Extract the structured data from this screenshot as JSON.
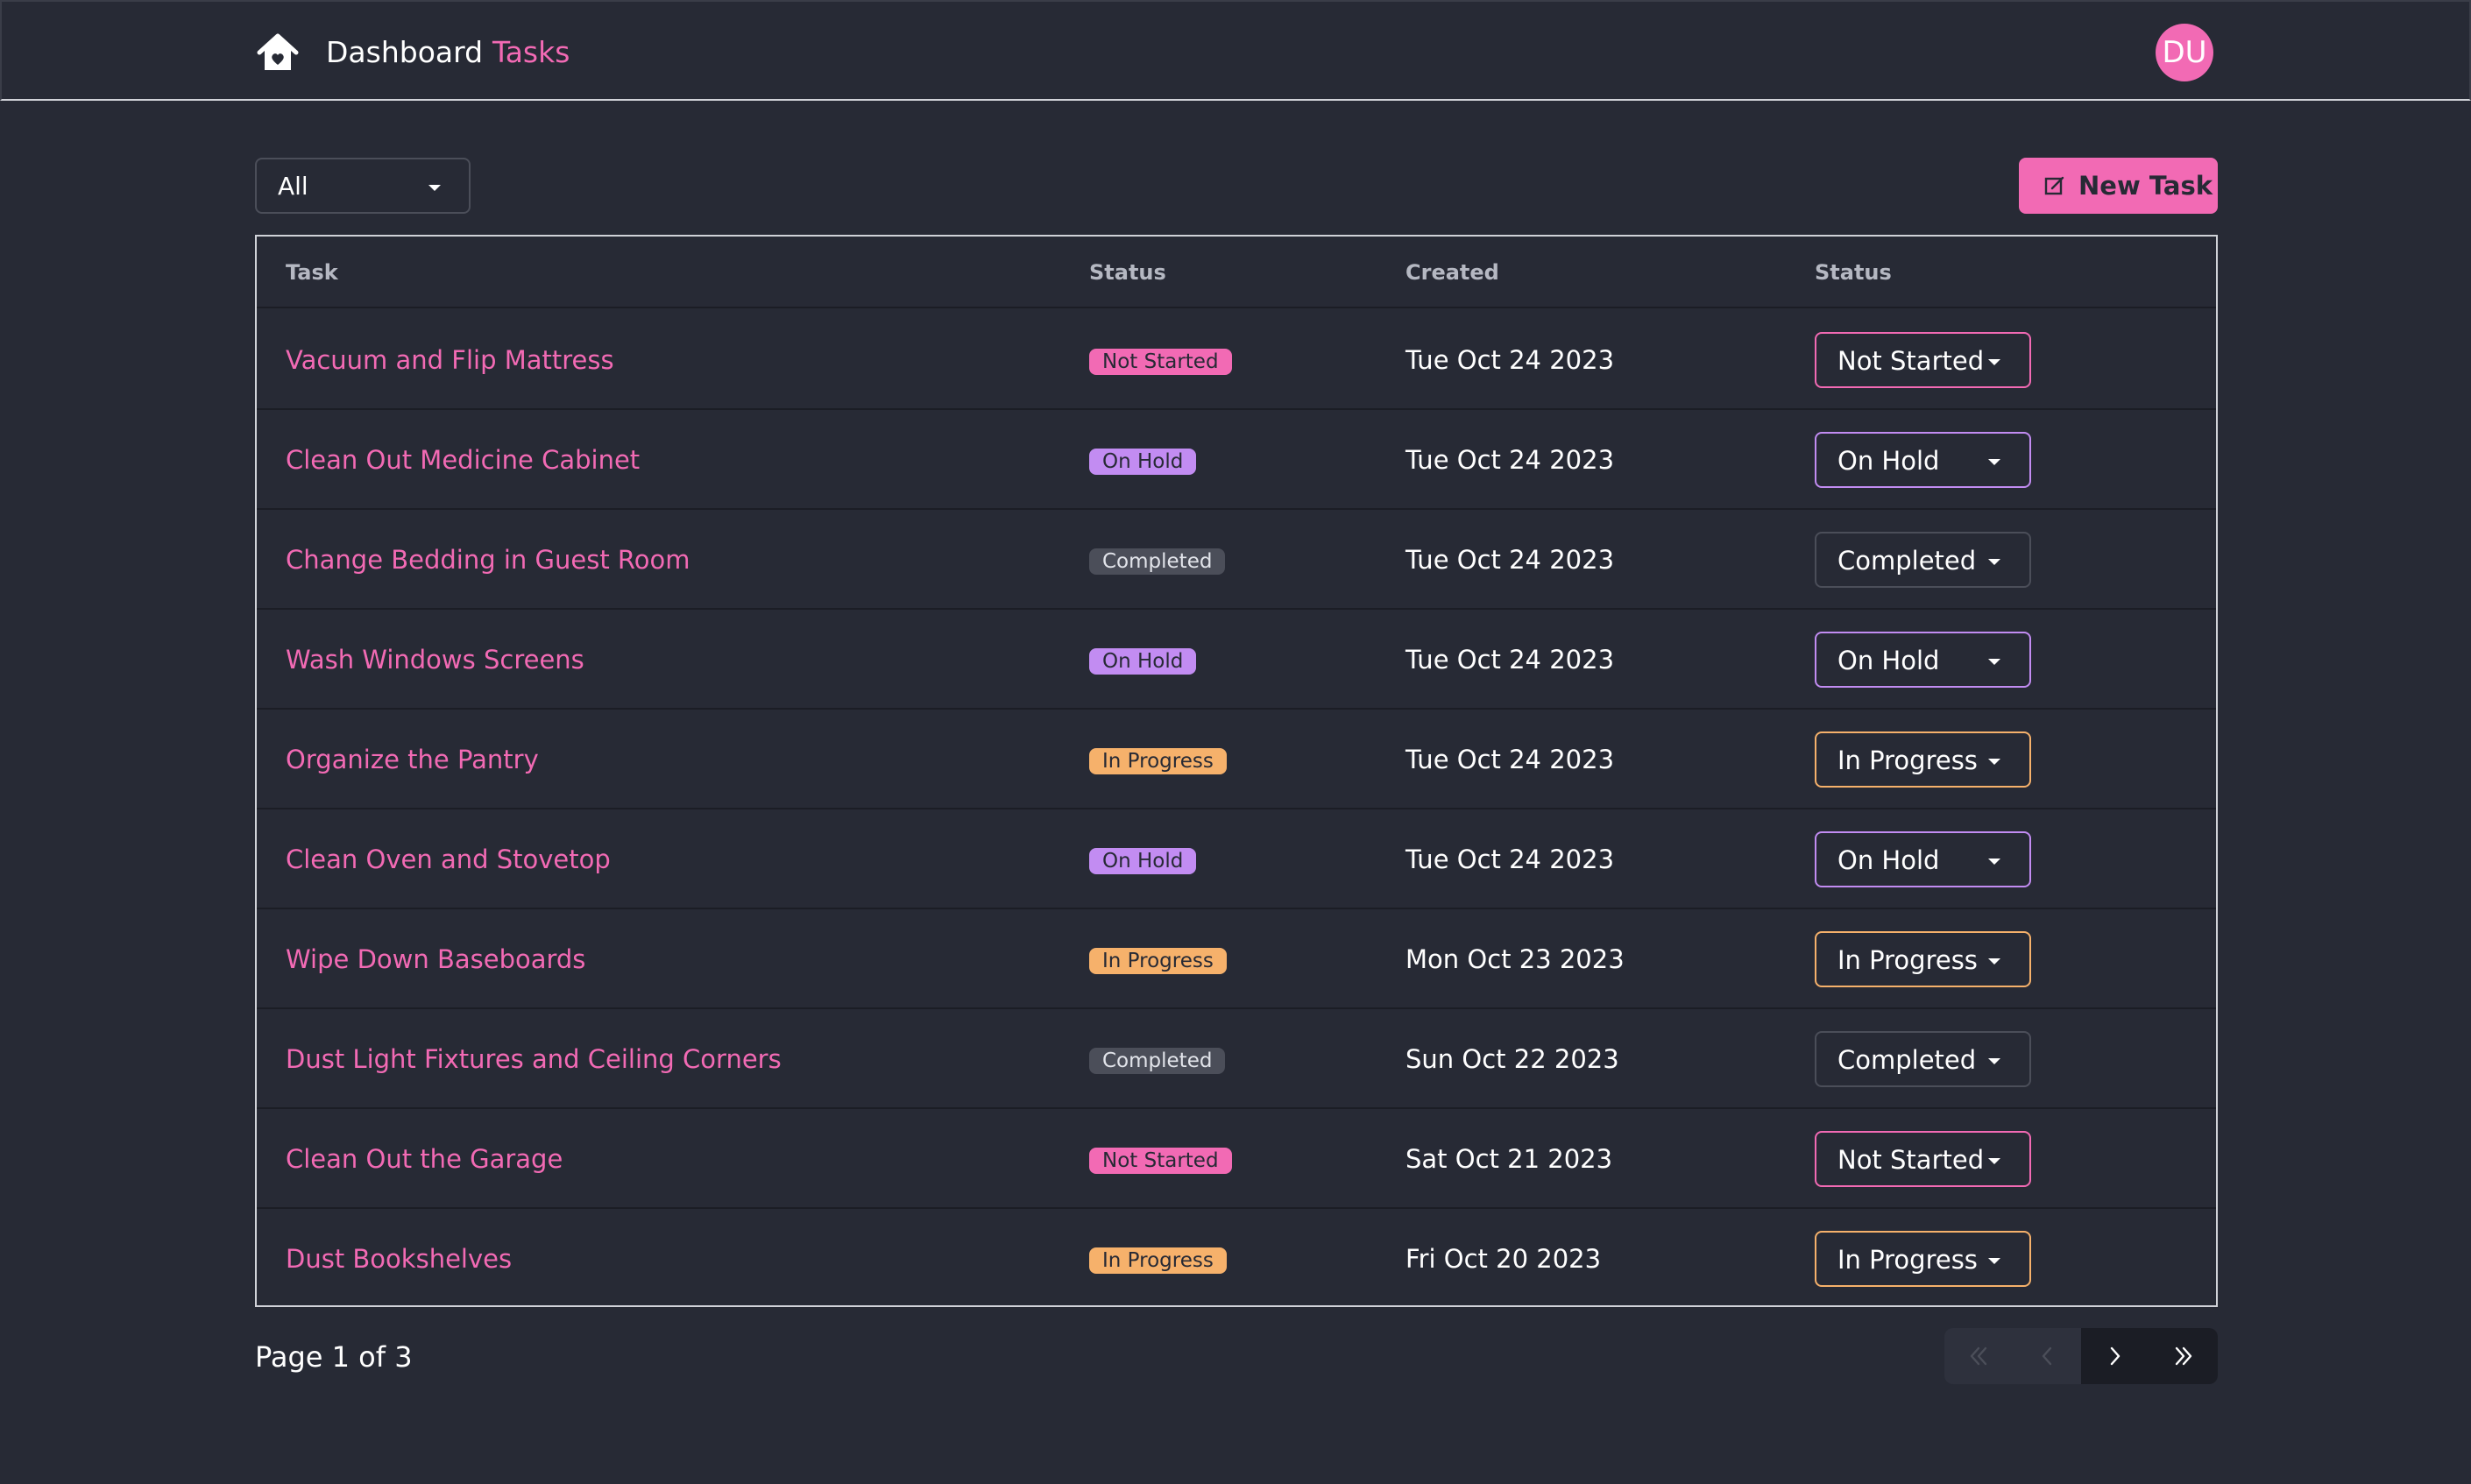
{
  "nav": {
    "dashboard_label": "Dashboard",
    "tasks_label": "Tasks",
    "avatar_initials": "DU",
    "home_icon": "home-icon"
  },
  "toolbar": {
    "filter_value": "All",
    "new_task_label": "New Task",
    "new_task_icon": "edit-icon"
  },
  "table": {
    "headers": {
      "task": "Task",
      "status": "Status",
      "created": "Created",
      "status2": "Status"
    },
    "rows": [
      {
        "task": "Vacuum and Flip Mattress",
        "status": "Not Started",
        "created": "Tue Oct 24 2023",
        "select": "Not Started"
      },
      {
        "task": "Clean Out Medicine Cabinet",
        "status": "On Hold",
        "created": "Tue Oct 24 2023",
        "select": "On Hold"
      },
      {
        "task": "Change Bedding in Guest Room",
        "status": "Completed",
        "created": "Tue Oct 24 2023",
        "select": "Completed"
      },
      {
        "task": "Wash Windows Screens",
        "status": "On Hold",
        "created": "Tue Oct 24 2023",
        "select": "On Hold"
      },
      {
        "task": "Organize the Pantry",
        "status": "In Progress",
        "created": "Tue Oct 24 2023",
        "select": "In Progress"
      },
      {
        "task": "Clean Oven and Stovetop",
        "status": "On Hold",
        "created": "Tue Oct 24 2023",
        "select": "On Hold"
      },
      {
        "task": "Wipe Down Baseboards",
        "status": "In Progress",
        "created": "Mon Oct 23 2023",
        "select": "In Progress"
      },
      {
        "task": "Dust Light Fixtures and Ceiling Corners",
        "status": "Completed",
        "created": "Sun Oct 22 2023",
        "select": "Completed"
      },
      {
        "task": "Clean Out the Garage",
        "status": "Not Started",
        "created": "Sat Oct 21 2023",
        "select": "Not Started"
      },
      {
        "task": "Dust Bookshelves",
        "status": "In Progress",
        "created": "Fri Oct 20 2023",
        "select": "In Progress"
      }
    ]
  },
  "status_colors": {
    "Not Started": {
      "bg": "#f26ab4",
      "fg": "#272a35",
      "border": "#f26ab4"
    },
    "On Hold": {
      "bg": "#c28cf2",
      "fg": "#272a35",
      "border": "#c28cf2"
    },
    "Completed": {
      "bg": "#4b4e59",
      "fg": "#e2e4ea",
      "border": "#4b4e59"
    },
    "In Progress": {
      "bg": "#f6b16b",
      "fg": "#272a35",
      "border": "#f6b16b"
    }
  },
  "footer": {
    "page_info": "Page 1 of 3",
    "pager_icons": [
      "chevrons-left-icon",
      "chevron-left-icon",
      "chevron-right-icon",
      "chevrons-right-icon"
    ]
  },
  "colors": {
    "accent": "#f26ab4",
    "background": "#272a35"
  }
}
